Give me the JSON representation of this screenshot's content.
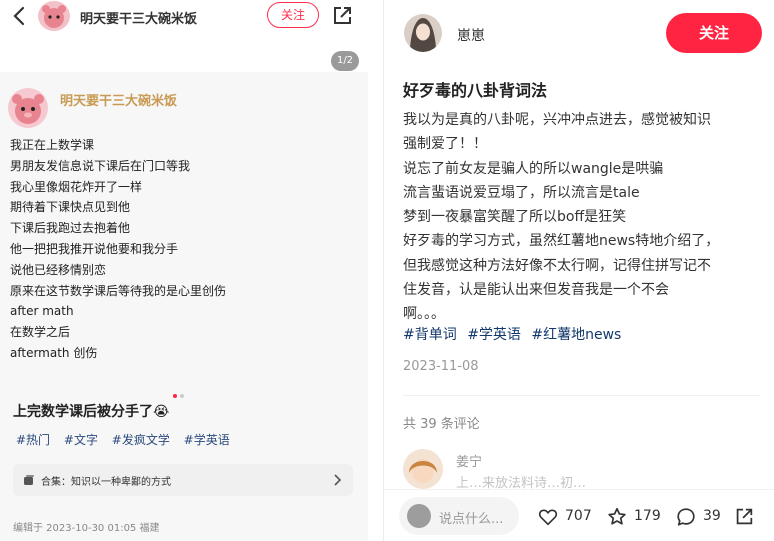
{
  "left_panel": {
    "username": "明天要干三大碗米饭",
    "follow_label": "关注",
    "page_indicator": "1/2",
    "card": {
      "username": "明天要干三大碗米饭",
      "lines": [
        "我正在上数学课",
        "男朋友发信息说下课后在门口等我",
        "我心里像烟花炸开了一样",
        "期待着下课快点见到他",
        "下课后我跑过去抱着他",
        "他一把把我推开说他要和我分手",
        "说他已经移情别恋",
        "原来在这节数学课后等待我的是心里创伤",
        "after math",
        "在数学之后",
        "aftermath 创伤"
      ]
    },
    "title": "上完数学课后被分手了😭",
    "tags": [
      "#热门",
      "#文字",
      "#发疯文学",
      "#学英语"
    ],
    "collection": {
      "label": "合集：知识以一种卑鄙的方式"
    },
    "edit_time": "编辑于 2023-10-30 01:05 福建"
  },
  "right_panel": {
    "username": "崽崽",
    "follow_label": "关注",
    "title": "好歹毒的八卦背词法",
    "body_lines": [
      "我以为是真的八卦呢，兴冲冲点进去，感觉被知识",
      "强制爱了！！",
      "说忘了前女友是骗人的所以wangle是哄骗",
      "流言蜚语说爱豆塌了，所以流言是tale",
      "梦到一夜暴富笑醒了所以boff是狂笑",
      "好歹毒的学习方式，虽然红薯地news特地介绍了，",
      "但我感觉这种方法好像不太行啊，记得住拼写记不",
      "住发音，认是能认出来但发音我是一个不会",
      "啊。。。"
    ],
    "tags": [
      "#背单词",
      "#学英语",
      "#红薯地news"
    ],
    "date": "2023-11-08",
    "comment_count": "共 39 条评论",
    "first_comment": {
      "name": "姜宁",
      "partial_text": "上…来放法料诗…初…"
    },
    "bottom_bar": {
      "comment_placeholder": "说点什么...",
      "likes": "707",
      "stars": "179",
      "comments": "39"
    }
  },
  "colors": {
    "accent": "#ff2442",
    "tag_blue": "#13386c",
    "card_username": "#c99a54"
  },
  "icons": [
    "back-icon",
    "share-icon",
    "heart-icon",
    "star-icon",
    "comment-icon",
    "chevron-right-icon",
    "collection-icon"
  ]
}
